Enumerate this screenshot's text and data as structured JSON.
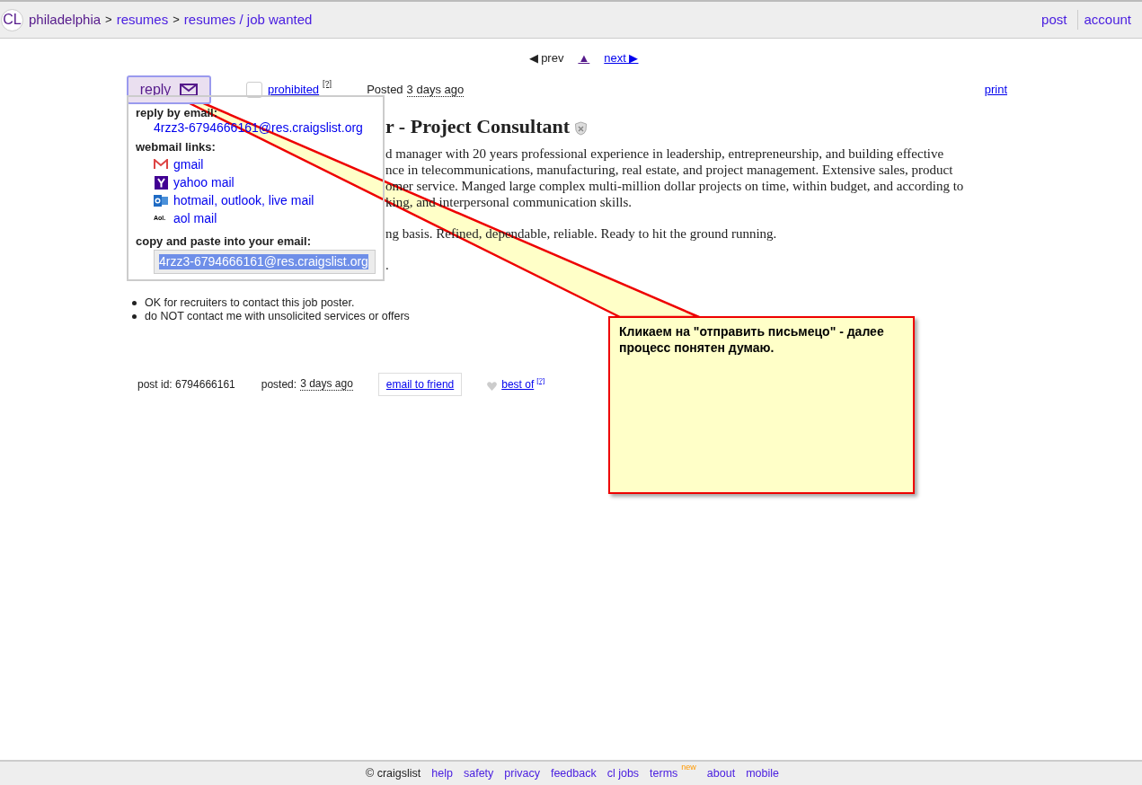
{
  "header": {
    "logo": "CL",
    "breadcrumbs": [
      {
        "label": "philadelphia",
        "visited": true
      },
      {
        "label": "resumes",
        "visited": false
      },
      {
        "label": "resumes / job wanted",
        "visited": false
      }
    ],
    "separator": ">",
    "links": [
      "post",
      "account"
    ]
  },
  "nav": {
    "prev": "◀ prev",
    "up": "▲",
    "next": "next ▶"
  },
  "actions": {
    "reply": "reply",
    "prohibited": {
      "label": "prohibited",
      "checked": false,
      "help": "[?]"
    },
    "posted_label": "Posted",
    "posted_time": "3 days ago",
    "print": "print"
  },
  "reply_popup": {
    "by_email_heading": "reply by email:",
    "email": "4rzz3-6794666161@res.craigslist.org",
    "webmail_heading": "webmail links:",
    "webmail": [
      {
        "kind": "gmail",
        "label": "gmail"
      },
      {
        "kind": "yahoo",
        "label": "yahoo mail"
      },
      {
        "kind": "outlook",
        "label": "hotmail, outlook, live mail"
      },
      {
        "kind": "aol",
        "badge": "Aol.",
        "label": "aol mail"
      }
    ],
    "copy_heading": "copy and paste into your email:",
    "copy_value": "4rzz3-6794666161@res.craigslist.org"
  },
  "posting": {
    "title": "r - Project Consultant",
    "paragraphs": [
      [
        "d manager with 20 years professional experience in leadership, entrepreneurship, and building effective",
        "nce in telecommunications, manufacturing, real estate, and project management. Extensive sales, product",
        "omer service. Manged large complex multi-million dollar projects on time, within budget, and according to",
        "king, and interpersonal communication skills."
      ],
      [
        "ng basis. Refined, dependable, reliable. Ready to hit the ground running."
      ],
      [
        "."
      ]
    ],
    "notices": [
      "OK for recruiters to contact this job poster.",
      "do NOT contact me with unsolicited services or offers"
    ]
  },
  "post_footer": {
    "post_id": "post id: 6794666161",
    "posted_label": "posted:",
    "posted_time": "3 days ago",
    "email_friend": "email to friend",
    "best_of": "best of",
    "help": "[?]"
  },
  "callout": {
    "text": "Кликаем на \"отправить письмецо\" - далее процесс понятен думаю."
  },
  "footer": {
    "copyright": "© craigslist",
    "links": [
      {
        "label": "help"
      },
      {
        "label": "safety"
      },
      {
        "label": "privacy"
      },
      {
        "label": "feedback"
      },
      {
        "label": "cl jobs"
      },
      {
        "label": "terms",
        "badge": "new"
      },
      {
        "label": "about"
      },
      {
        "label": "mobile"
      }
    ]
  }
}
